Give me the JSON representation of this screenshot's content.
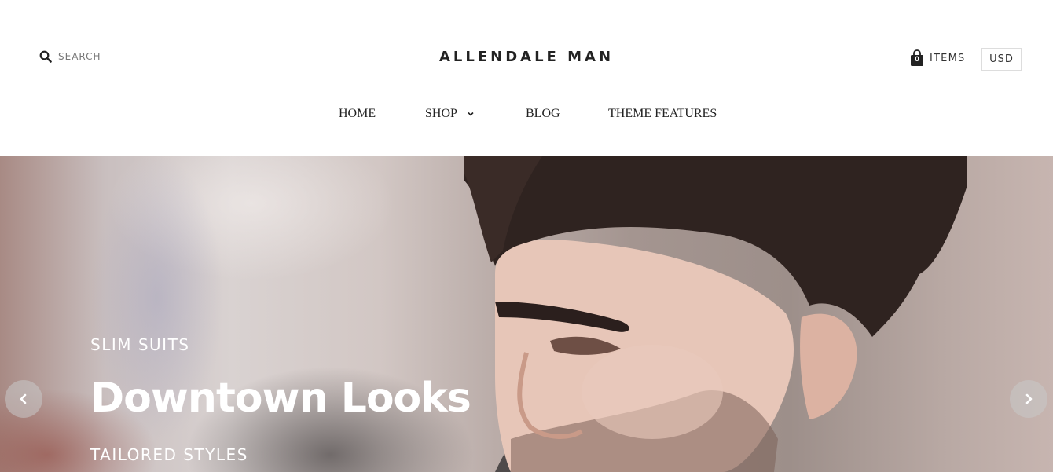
{
  "header": {
    "search": {
      "placeholder": "SEARCH",
      "icon": "search-icon"
    },
    "logo": "ALLENDALE MAN",
    "cart": {
      "count": "0",
      "label": "ITEMS",
      "icon": "shopping-bag-icon"
    },
    "currency": "USD"
  },
  "nav": {
    "items": [
      {
        "label": "HOME"
      },
      {
        "label": "SHOP",
        "has_dropdown": true
      },
      {
        "label": "BLOG"
      },
      {
        "label": "THEME FEATURES"
      }
    ]
  },
  "hero": {
    "subtitle": "SLIM SUITS",
    "title": "Downtown Looks",
    "tagline": "TAILORED STYLES",
    "prev_icon": "chevron-left-icon",
    "next_icon": "chevron-right-icon"
  },
  "colors": {
    "text": "#222222",
    "hero_text": "#ffffff",
    "border": "#dddddd",
    "arrow_bg": "rgba(200,200,200,0.55)"
  }
}
